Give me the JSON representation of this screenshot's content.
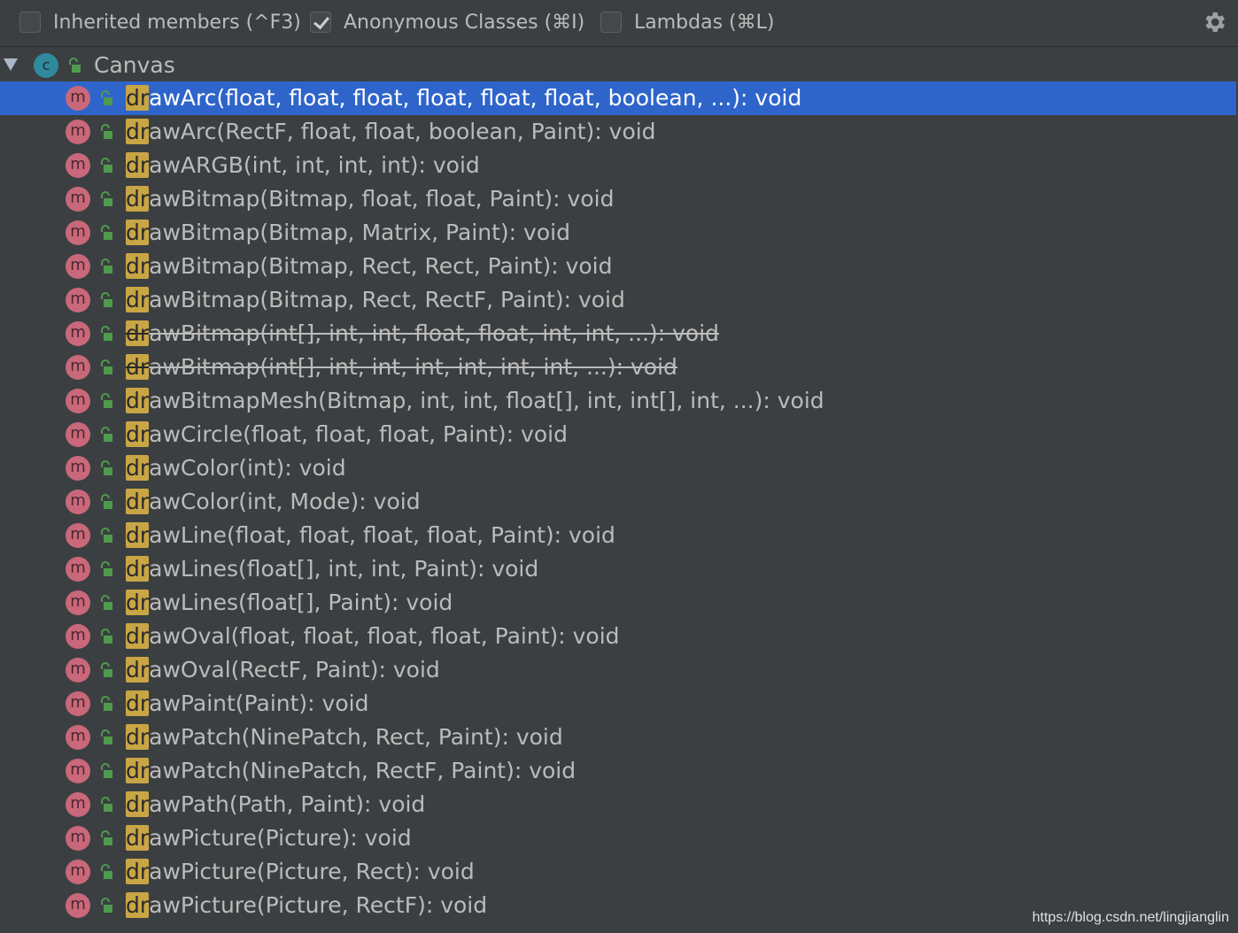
{
  "toolbar": {
    "options": [
      {
        "label": "Inherited members (^F3)",
        "checked": false
      },
      {
        "label": "Anonymous Classes (⌘I)",
        "checked": true
      },
      {
        "label": "Lambdas (⌘L)",
        "checked": false
      }
    ],
    "settings_icon": "gear-icon"
  },
  "tree": {
    "root": {
      "icon_letter": "c",
      "label": "Canvas",
      "expanded": true
    },
    "match_prefix": "dr",
    "method_icon_letter": "m",
    "items": [
      {
        "rest": "awArc(float, float, float, float, float, float, boolean, ...): void",
        "selected": true,
        "deprecated": false
      },
      {
        "rest": "awArc(RectF, float, float, boolean, Paint): void",
        "selected": false,
        "deprecated": false
      },
      {
        "rest": "awARGB(int, int, int, int): void",
        "selected": false,
        "deprecated": false
      },
      {
        "rest": "awBitmap(Bitmap, float, float, Paint): void",
        "selected": false,
        "deprecated": false
      },
      {
        "rest": "awBitmap(Bitmap, Matrix, Paint): void",
        "selected": false,
        "deprecated": false
      },
      {
        "rest": "awBitmap(Bitmap, Rect, Rect, Paint): void",
        "selected": false,
        "deprecated": false
      },
      {
        "rest": "awBitmap(Bitmap, Rect, RectF, Paint): void",
        "selected": false,
        "deprecated": false
      },
      {
        "rest": "awBitmap(int[], int, int, float, float, int, int, ...): void",
        "selected": false,
        "deprecated": true
      },
      {
        "rest": "awBitmap(int[], int, int, int, int, int, int, ...): void",
        "selected": false,
        "deprecated": true
      },
      {
        "rest": "awBitmapMesh(Bitmap, int, int, float[], int, int[], int, ...): void",
        "selected": false,
        "deprecated": false
      },
      {
        "rest": "awCircle(float, float, float, Paint): void",
        "selected": false,
        "deprecated": false
      },
      {
        "rest": "awColor(int): void",
        "selected": false,
        "deprecated": false
      },
      {
        "rest": "awColor(int, Mode): void",
        "selected": false,
        "deprecated": false
      },
      {
        "rest": "awLine(float, float, float, float, Paint): void",
        "selected": false,
        "deprecated": false
      },
      {
        "rest": "awLines(float[], int, int, Paint): void",
        "selected": false,
        "deprecated": false
      },
      {
        "rest": "awLines(float[], Paint): void",
        "selected": false,
        "deprecated": false
      },
      {
        "rest": "awOval(float, float, float, float, Paint): void",
        "selected": false,
        "deprecated": false
      },
      {
        "rest": "awOval(RectF, Paint): void",
        "selected": false,
        "deprecated": false
      },
      {
        "rest": "awPaint(Paint): void",
        "selected": false,
        "deprecated": false
      },
      {
        "rest": "awPatch(NinePatch, Rect, Paint): void",
        "selected": false,
        "deprecated": false
      },
      {
        "rest": "awPatch(NinePatch, RectF, Paint): void",
        "selected": false,
        "deprecated": false
      },
      {
        "rest": "awPath(Path, Paint): void",
        "selected": false,
        "deprecated": false
      },
      {
        "rest": "awPicture(Picture): void",
        "selected": false,
        "deprecated": false
      },
      {
        "rest": "awPicture(Picture, Rect): void",
        "selected": false,
        "deprecated": false
      },
      {
        "rest": "awPicture(Picture, RectF): void",
        "selected": false,
        "deprecated": false
      }
    ]
  },
  "watermark": "https://blog.csdn.net/lingjianglin",
  "colors": {
    "background": "#3c3f41",
    "selection": "#2f65ca",
    "match_highlight": "#c9a645",
    "method_icon": "#c9687a",
    "class_icon": "#2f8a9d",
    "access_icon": "#4e9a4e"
  }
}
